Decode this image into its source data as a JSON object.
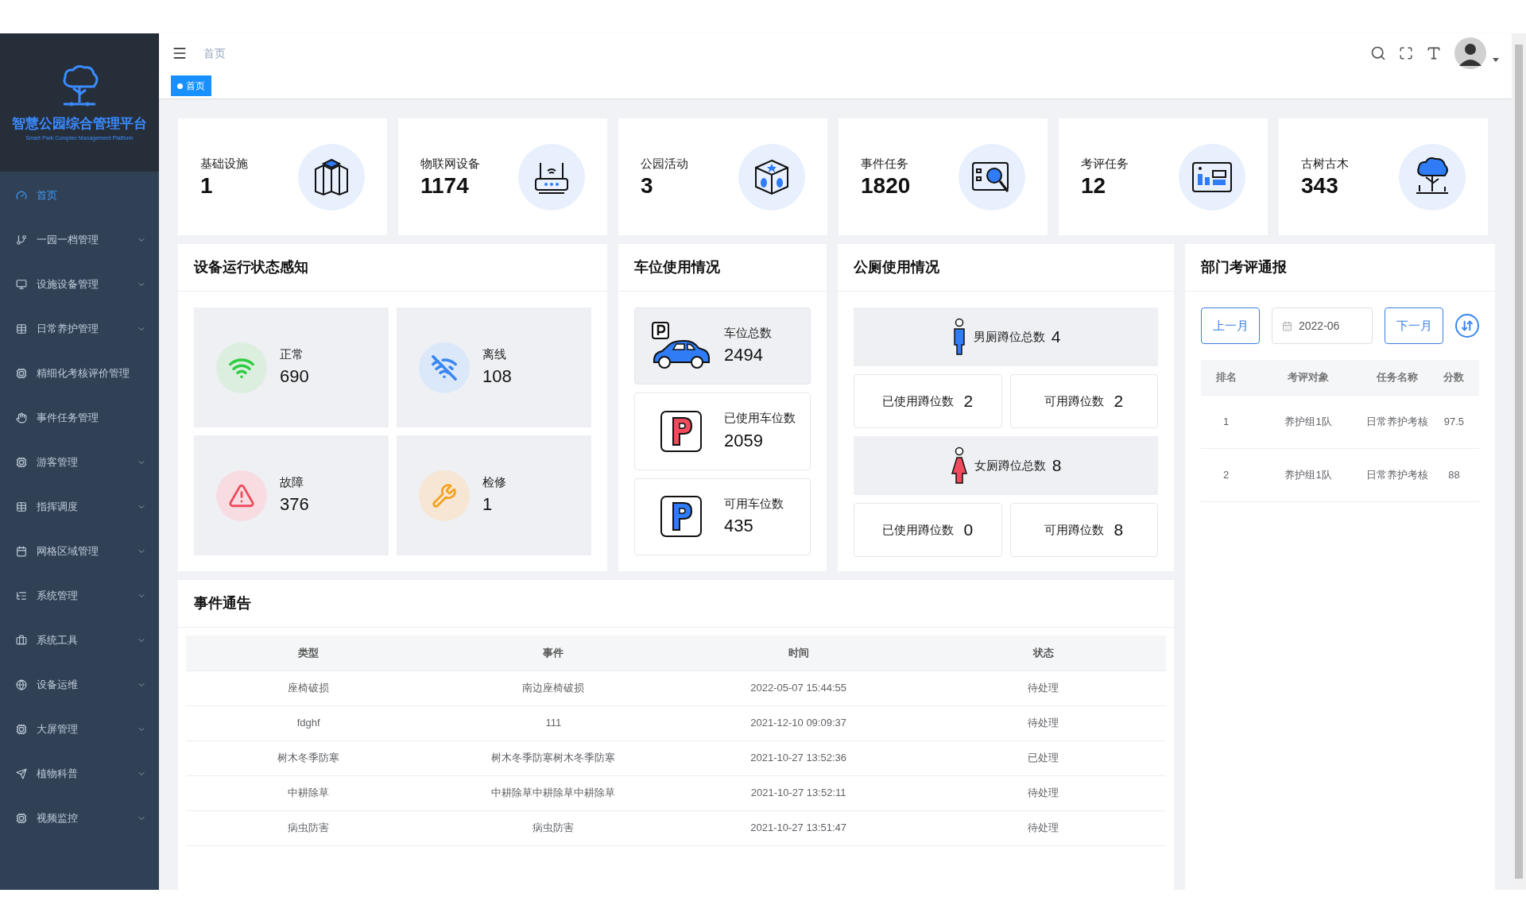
{
  "sidebar": {
    "logo": {
      "title": "智慧公园综合管理平台",
      "subtitle": "Smart Park Complex Management Platform"
    },
    "items": [
      {
        "label": "首页",
        "selected": true,
        "expandable": false,
        "kind": "gauge"
      },
      {
        "label": "一园一档管理",
        "selected": false,
        "expandable": true,
        "kind": "tree"
      },
      {
        "label": "设施设备管理",
        "selected": false,
        "expandable": true,
        "kind": "monitor"
      },
      {
        "label": "日常养护管理",
        "selected": false,
        "expandable": true,
        "kind": "table"
      },
      {
        "label": "精细化考核评价管理",
        "selected": false,
        "expandable": false,
        "kind": "screen"
      },
      {
        "label": "事件任务管理",
        "selected": false,
        "expandable": false,
        "kind": "hand"
      },
      {
        "label": "游客管理",
        "selected": false,
        "expandable": true,
        "kind": "screen"
      },
      {
        "label": "指挥调度",
        "selected": false,
        "expandable": true,
        "kind": "table"
      },
      {
        "label": "网格区域管理",
        "selected": false,
        "expandable": true,
        "kind": "calendar"
      },
      {
        "label": "系统管理",
        "selected": false,
        "expandable": true,
        "kind": "list"
      },
      {
        "label": "系统工具",
        "selected": false,
        "expandable": true,
        "kind": "toolbox"
      },
      {
        "label": "设备运维",
        "selected": false,
        "expandable": true,
        "kind": "globe"
      },
      {
        "label": "大屏管理",
        "selected": false,
        "expandable": true,
        "kind": "screen"
      },
      {
        "label": "植物科普",
        "selected": false,
        "expandable": true,
        "kind": "send"
      },
      {
        "label": "视频监控",
        "selected": false,
        "expandable": true,
        "kind": "screen"
      }
    ]
  },
  "navbar": {
    "breadcrumb": "首页"
  },
  "tags": [
    {
      "label": "首页",
      "selected": true
    }
  ],
  "stats": [
    {
      "label": "基础设施",
      "value": "1",
      "kind": "cubes"
    },
    {
      "label": "物联网设备",
      "value": "1174",
      "kind": "router"
    },
    {
      "label": "公园活动",
      "value": "3",
      "kind": "box"
    },
    {
      "label": "事件任务",
      "value": "1820",
      "kind": "inspect"
    },
    {
      "label": "考评任务",
      "value": "12",
      "kind": "board"
    },
    {
      "label": "古树古木",
      "value": "343",
      "kind": "tree"
    }
  ],
  "device_status": {
    "title": "设备运行状态感知",
    "items": [
      {
        "label": "正常",
        "value": "690",
        "kind": "normal"
      },
      {
        "label": "离线",
        "value": "108",
        "kind": "offline"
      },
      {
        "label": "故障",
        "value": "376",
        "kind": "fault"
      },
      {
        "label": "检修",
        "value": "1",
        "kind": "repair"
      }
    ]
  },
  "parking": {
    "title": "车位使用情况",
    "items": [
      {
        "label": "车位总数",
        "value": "2494",
        "kind": "total"
      },
      {
        "label": "已使用车位数",
        "value": "2059",
        "kind": "used"
      },
      {
        "label": "可用车位数",
        "value": "435",
        "kind": "free"
      }
    ]
  },
  "toilets": {
    "title": "公厕使用情况",
    "groups": [
      {
        "kind": "male",
        "label": "男厕蹲位总数",
        "value": "4",
        "used_label": "已使用蹲位数",
        "used_value": "2",
        "free_label": "可用蹲位数",
        "free_value": "2"
      },
      {
        "kind": "female",
        "label": "女厕蹲位总数",
        "value": "8",
        "used_label": "已使用蹲位数",
        "used_value": "0",
        "free_label": "可用蹲位数",
        "free_value": "8"
      }
    ]
  },
  "evaluation": {
    "title": "部门考评通报",
    "prev_button": "上一月",
    "month": "2022-06",
    "next_button": "下一月",
    "columns": [
      "排名",
      "考评对象",
      "任务名称",
      "分数"
    ],
    "rows": [
      [
        "1",
        "养护组1队",
        "日常养护考核",
        "97.5"
      ],
      [
        "2",
        "养护组1队",
        "日常养护考核",
        "88"
      ]
    ]
  },
  "events": {
    "title": "事件通告",
    "columns": [
      "类型",
      "事件",
      "时间",
      "状态"
    ],
    "rows": [
      [
        "座椅破损",
        "南边座椅破损",
        "2022-05-07 15:44:55",
        "待处理"
      ],
      [
        "fdghf",
        "111",
        "2021-12-10 09:09:37",
        "待处理"
      ],
      [
        "树木冬季防寒",
        "树木冬季防寒树木冬季防寒",
        "2021-10-27 13:52:36",
        "已处理"
      ],
      [
        "中耕除草",
        "中耕除草中耕除草中耕除草",
        "2021-10-27 13:52:11",
        "待处理"
      ],
      [
        "病虫防害",
        "病虫防害",
        "2021-10-27 13:51:47",
        "待处理"
      ]
    ]
  }
}
